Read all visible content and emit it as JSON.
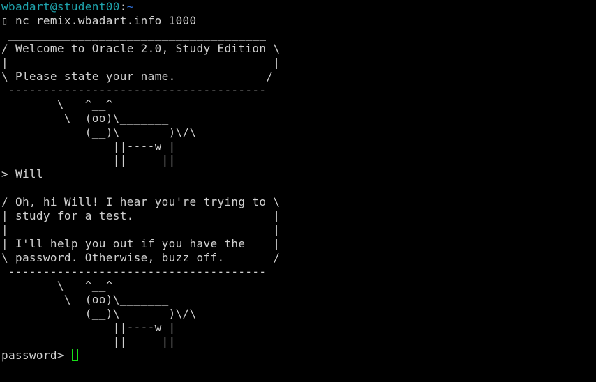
{
  "colors": {
    "background": "#000000",
    "foreground": "#d0d0d0",
    "user_host": "#1fa4ad",
    "path": "#2f6fd6",
    "cursor": "#19e019"
  },
  "prompt": {
    "user_host": "wbadart@student00",
    "separator": ":",
    "path": "~"
  },
  "lines": [
    "▯ nc remix.wbadart.info 1000",
    " _____________________________________",
    "/ Welcome to Oracle 2.0, Study Edition \\",
    "|                                      |",
    "\\ Please state your name.             /",
    " -------------------------------------",
    "        \\   ^__^",
    "         \\  (oo)\\_______",
    "            (__)\\       )\\/\\",
    "                ||----w |",
    "                ||     ||",
    "> Will",
    " _____________________________________",
    "/ Oh, hi Will! I hear you're trying to \\",
    "| study for a test.                    |",
    "|                                      |",
    "| I'll help you out if you have the    |",
    "\\ password. Otherwise, buzz off.       /",
    " -------------------------------------",
    "        \\   ^__^",
    "         \\  (oo)\\_______",
    "            (__)\\       )\\/\\",
    "                ||----w |",
    "                ||     ||"
  ],
  "input_prompt": "password> "
}
